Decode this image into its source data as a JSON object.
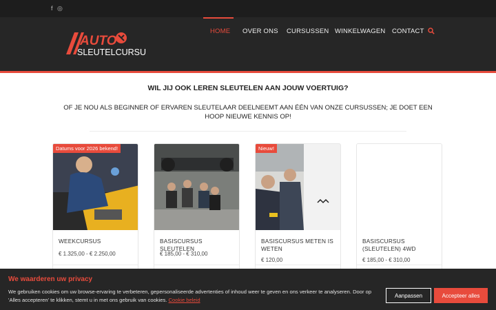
{
  "topbar": {
    "facebook_icon": "facebook-icon",
    "instagram_icon": "instagram-icon",
    "facebook_glyph": "f",
    "instagram_glyph": "◎"
  },
  "logo": {
    "line1": "AUTO",
    "line2": "SLEUTELCURSUS"
  },
  "nav": {
    "items": [
      {
        "label": "HOME"
      },
      {
        "label": "OVER ONS"
      },
      {
        "label": "CURSUSSEN"
      },
      {
        "label": "WINKELWAGEN"
      },
      {
        "label": "CONTACT"
      }
    ],
    "search_icon": "search-icon"
  },
  "intro": {
    "title": "WIL JIJ OOK LEREN SLEUTELEN AAN JOUW VOERTUIG?",
    "text": "OF JE NOU ALS BEGINNER OF ERVAREN SLEUTELAAR DEELNEEMT AAN ÉÉN VAN ONZE CURSUSSEN; JE DOET EEN HOOP NIEUWE KENNIS OP!"
  },
  "products": [
    {
      "badge": "Datums voor 2026 bekend!",
      "title": "WEEKCURSUS",
      "price": "€ 1.325,00 - € 2.250,00"
    },
    {
      "badge": "",
      "title": "BASISCURSUS SLEUTELEN",
      "price": "€ 185,00 - € 310,00"
    },
    {
      "badge": "Nieuw!",
      "title": "BASISCURSUS METEN IS WETEN",
      "price": "€ 120,00"
    },
    {
      "badge": "",
      "title": "BASISCURSUS (SLEUTELEN) 4WD",
      "price": "€ 185,00 - € 310,00"
    }
  ],
  "cookie": {
    "title": "We waarderen uw privacy",
    "text": "We gebruiken cookies om uw browse-ervaring te verbeteren, gepersonaliseerde advertenties of inhoud weer te geven en ons verkeer te analyseren. Door op 'Alles accepteren' te klikken, stemt u in met ons gebruik van cookies.",
    "link": "Cookie beleid",
    "customize": "Aanpassen",
    "accept": "Accepteer alles"
  },
  "colors": {
    "accent": "#e84b3c",
    "header_bg": "#262626",
    "topbar_bg": "#1d1d1d"
  }
}
